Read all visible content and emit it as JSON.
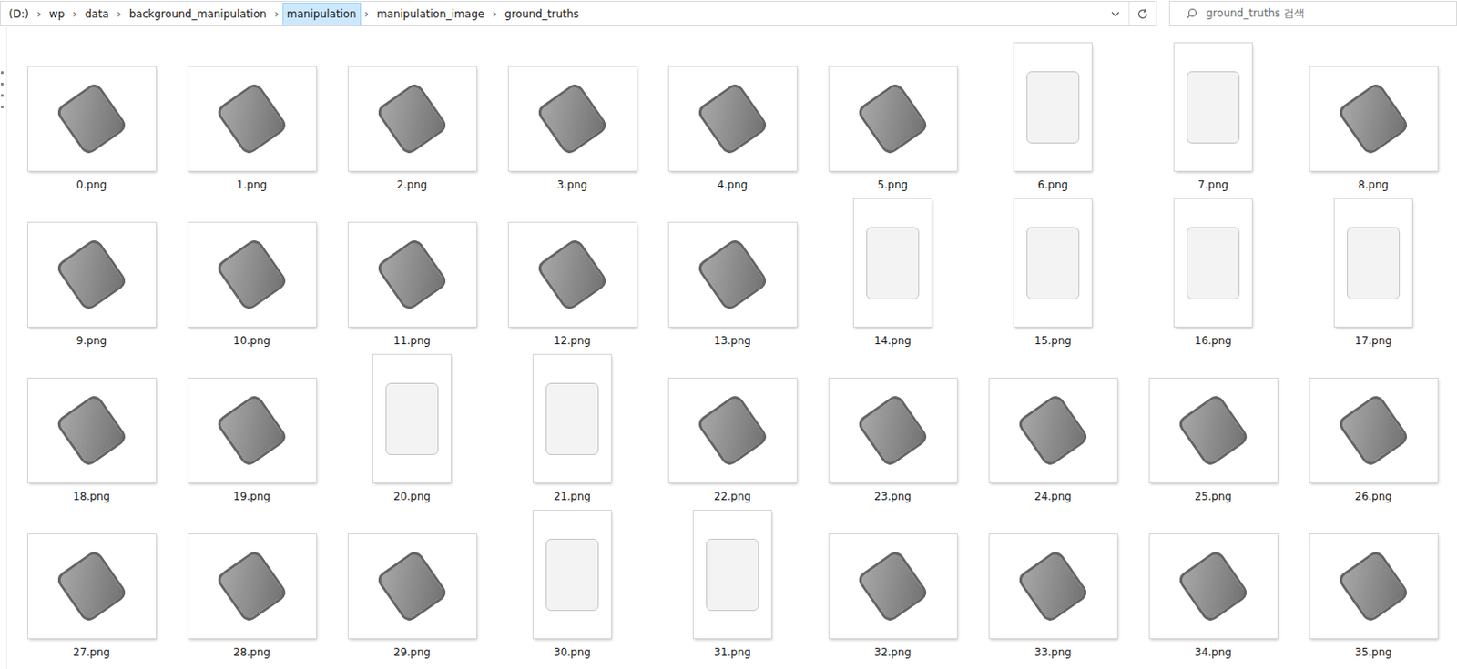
{
  "address_bar": {
    "separator": "›",
    "crumbs": [
      {
        "label": "(D:)",
        "selected": false
      },
      {
        "label": "wp",
        "selected": false
      },
      {
        "label": "data",
        "selected": false
      },
      {
        "label": "background_manipulation",
        "selected": false
      },
      {
        "label": "manipulation",
        "selected": true
      },
      {
        "label": "manipulation_image",
        "selected": false
      },
      {
        "label": "ground_truths",
        "selected": false
      }
    ]
  },
  "search": {
    "placeholder": "ground_truths 검색"
  },
  "files": [
    {
      "name": "0.png",
      "kind": "landscape"
    },
    {
      "name": "1.png",
      "kind": "landscape"
    },
    {
      "name": "2.png",
      "kind": "landscape"
    },
    {
      "name": "3.png",
      "kind": "landscape"
    },
    {
      "name": "4.png",
      "kind": "landscape"
    },
    {
      "name": "5.png",
      "kind": "landscape"
    },
    {
      "name": "6.png",
      "kind": "portrait"
    },
    {
      "name": "7.png",
      "kind": "portrait"
    },
    {
      "name": "8.png",
      "kind": "landscape"
    },
    {
      "name": "9.png",
      "kind": "landscape"
    },
    {
      "name": "10.png",
      "kind": "landscape"
    },
    {
      "name": "11.png",
      "kind": "landscape"
    },
    {
      "name": "12.png",
      "kind": "landscape"
    },
    {
      "name": "13.png",
      "kind": "landscape"
    },
    {
      "name": "14.png",
      "kind": "portrait"
    },
    {
      "name": "15.png",
      "kind": "portrait"
    },
    {
      "name": "16.png",
      "kind": "portrait"
    },
    {
      "name": "17.png",
      "kind": "portrait"
    },
    {
      "name": "18.png",
      "kind": "landscape"
    },
    {
      "name": "19.png",
      "kind": "landscape"
    },
    {
      "name": "20.png",
      "kind": "portrait"
    },
    {
      "name": "21.png",
      "kind": "portrait"
    },
    {
      "name": "22.png",
      "kind": "landscape"
    },
    {
      "name": "23.png",
      "kind": "landscape"
    },
    {
      "name": "24.png",
      "kind": "landscape"
    },
    {
      "name": "25.png",
      "kind": "landscape"
    },
    {
      "name": "26.png",
      "kind": "landscape"
    },
    {
      "name": "27.png",
      "kind": "landscape"
    },
    {
      "name": "28.png",
      "kind": "landscape"
    },
    {
      "name": "29.png",
      "kind": "landscape"
    },
    {
      "name": "30.png",
      "kind": "portrait"
    },
    {
      "name": "31.png",
      "kind": "portrait"
    },
    {
      "name": "32.png",
      "kind": "landscape"
    },
    {
      "name": "33.png",
      "kind": "landscape"
    },
    {
      "name": "34.png",
      "kind": "landscape"
    },
    {
      "name": "35.png",
      "kind": "landscape"
    }
  ]
}
